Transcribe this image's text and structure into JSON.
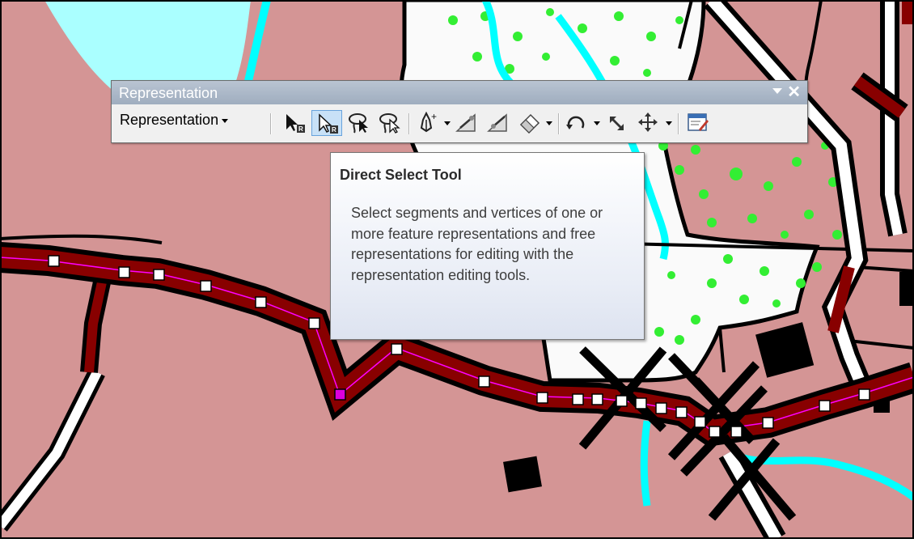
{
  "toolbar": {
    "title": "Representation",
    "menu_label": "Representation",
    "tools": [
      {
        "icon": "select-tool-icon",
        "state": "normal"
      },
      {
        "icon": "direct-select-tool-icon",
        "state": "active"
      },
      {
        "icon": "lasso-select-tool-icon",
        "state": "normal"
      },
      {
        "icon": "lasso-direct-select-tool-icon",
        "state": "normal"
      },
      {
        "icon": "add-vertex-icon",
        "state": "normal",
        "dropdown": true
      },
      {
        "icon": "edit-tool-icon",
        "state": "normal"
      },
      {
        "icon": "edit-tool-icon",
        "state": "normal"
      },
      {
        "icon": "eraser-icon",
        "state": "normal",
        "dropdown": true
      },
      {
        "icon": "rotate-icon",
        "state": "normal",
        "dropdown": true
      },
      {
        "icon": "resize-icon",
        "state": "normal"
      },
      {
        "icon": "move-icon",
        "state": "normal",
        "dropdown": true
      },
      {
        "icon": "properties-icon",
        "state": "normal"
      }
    ]
  },
  "tooltip": {
    "title": "Direct Select Tool",
    "body": "Select segments and vertices of one or more feature representations and free representations for editing with the representation editing tools."
  },
  "map": {
    "colors": {
      "land": "#d49595",
      "water_fill": "#aaffff",
      "water_line": "#00ffff",
      "vegetation_bg": "#fafafa",
      "vegetation_dots": "#33ee33",
      "road_fill": "#880000",
      "road_outline": "#000000",
      "selected_line": "#ff00ff",
      "vertex": "#ffffff",
      "vertex_selected": "#dd00dd"
    }
  }
}
